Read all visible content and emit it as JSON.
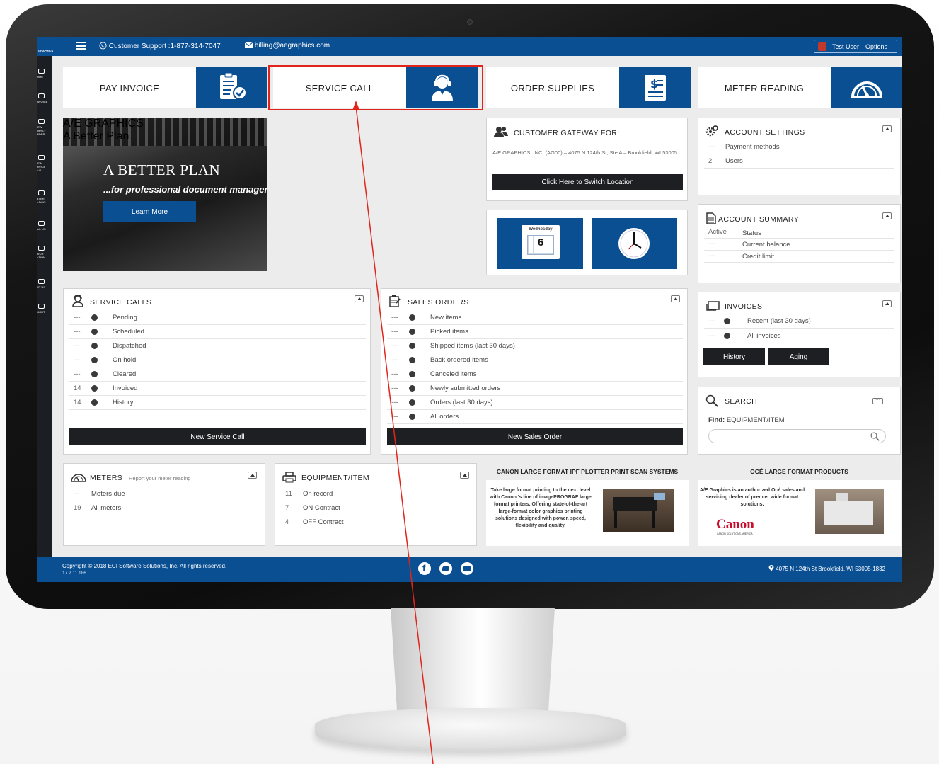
{
  "topbar": {
    "logo": "GRAPHICS",
    "support": "Customer Support :1-877-314-7047",
    "billing": "billing@aegraphics.com",
    "user": "Test User",
    "options": "Options"
  },
  "sidebar": {
    "items": [
      {
        "label": "OME"
      },
      {
        "label": "NVOICE"
      },
      {
        "label": "IEW\nUPPLY\nRDER"
      },
      {
        "label": "IEW\nRVICE\nALL"
      },
      {
        "label": "ETER\nADING"
      },
      {
        "label": "AIL US"
      },
      {
        "label": "ITCH\nATION"
      },
      {
        "label": "UT US"
      },
      {
        "label": "GOUT"
      }
    ]
  },
  "actions": {
    "pay_invoice": "PAY INVOICE",
    "service_call": "SERVICE CALL",
    "order_supplies": "ORDER SUPPLIES",
    "meter_reading": "METER READING"
  },
  "banner": {
    "title": "A BETTER PLAN",
    "subtitle": "...for professional document management & printing",
    "learn_more": "Learn More",
    "brand": "A/E GRAPHICS",
    "brand_sub": "A Better Plan"
  },
  "gateway": {
    "title": "CUSTOMER GATEWAY FOR:",
    "address": "A/E GRAPHICS, INC. (AG00) – 4075 N 124th St, Ste A – Brookfield, WI 53005",
    "switch_button": "Click Here to Switch Location"
  },
  "calendar": {
    "weekday": "Wednesday",
    "day": "6"
  },
  "account_settings": {
    "title": "ACCOUNT SETTINGS",
    "rows": [
      {
        "count": "---",
        "label": "Payment methods"
      },
      {
        "count": "2",
        "label": "Users"
      }
    ]
  },
  "account_summary": {
    "title": "ACCOUNT SUMMARY",
    "rows": [
      {
        "count": "Active",
        "label": "Status"
      },
      {
        "count": "---",
        "label": "Current balance"
      },
      {
        "count": "---",
        "label": "Credit limit"
      }
    ]
  },
  "service_calls": {
    "title": "SERVICE CALLS",
    "rows": [
      {
        "count": "---",
        "label": "Pending"
      },
      {
        "count": "---",
        "label": "Scheduled"
      },
      {
        "count": "---",
        "label": "Dispatched"
      },
      {
        "count": "---",
        "label": "On hold"
      },
      {
        "count": "---",
        "label": "Cleared"
      },
      {
        "count": "14",
        "label": "Invoiced"
      },
      {
        "count": "14",
        "label": "History"
      }
    ],
    "button": "New Service Call"
  },
  "sales_orders": {
    "title": "SALES ORDERS",
    "rows": [
      {
        "count": "---",
        "label": "New items"
      },
      {
        "count": "---",
        "label": "Picked items"
      },
      {
        "count": "---",
        "label": "Shipped items (last 30 days)"
      },
      {
        "count": "---",
        "label": "Back ordered items"
      },
      {
        "count": "---",
        "label": "Canceled items"
      },
      {
        "count": "---",
        "label": "Newly submitted orders"
      },
      {
        "count": "---",
        "label": "Orders (last 30 days)"
      },
      {
        "count": "---",
        "label": "All orders"
      }
    ],
    "button": "New Sales Order"
  },
  "invoices": {
    "title": "INVOICES",
    "rows": [
      {
        "count": "---",
        "label": "Recent (last 30 days)"
      },
      {
        "count": "---",
        "label": "All invoices"
      }
    ],
    "history": "History",
    "aging": "Aging"
  },
  "search": {
    "title": "SEARCH",
    "find_label": "Find:",
    "find_value": "EQUIPMENT/ITEM"
  },
  "meters": {
    "title": "METERS",
    "subtitle": "Report your meter reading",
    "rows": [
      {
        "count": "---",
        "label": "Meters due"
      },
      {
        "count": "19",
        "label": "All meters"
      }
    ]
  },
  "equipment": {
    "title": "EQUIPMENT/ITEM",
    "rows": [
      {
        "count": "11",
        "label": "On record"
      },
      {
        "count": "7",
        "label": "ON Contract"
      },
      {
        "count": "4",
        "label": "OFF Contract"
      }
    ]
  },
  "ad_canon": {
    "title": "CANON LARGE FORMAT IPF PLOTTER PRINT SCAN SYSTEMS",
    "text": "Take large format printing to the next level with Canon 's line of imagePROGRAF large format printers. Offering state-of-the-art large-format color graphics printing solutions designed with power, speed, flexibility and quality."
  },
  "ad_oce": {
    "title": "OCÉ LARGE FORMAT PRODUCTS",
    "text": "A/E Graphics is an authorized Océ sales and servicing dealer of premier wide format solutions.",
    "logo": "Canon",
    "logo_sub": "CANON SOLUTIONS AMERICA"
  },
  "footer": {
    "copyright": "Copyright © 2018 ECI Software Solutions, Inc. All rights reserved.",
    "version": "17.2.11.186",
    "address": "4075 N 124th St Brookfield, WI 53005-1832"
  },
  "colors": {
    "brand_blue": "#0b4f93",
    "highlight_red": "#e1251b",
    "dark_button": "#1d1f22"
  }
}
